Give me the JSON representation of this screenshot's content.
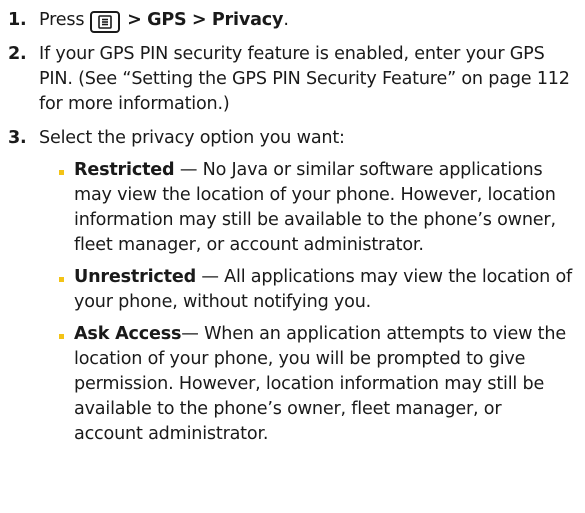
{
  "steps": [
    {
      "number": "1.",
      "text_before": "Press",
      "icon": "menu-key-icon",
      "path_sep1": ">",
      "path_item1": "GPS",
      "path_sep2": ">",
      "path_item2": "Privacy",
      "text_after": "."
    },
    {
      "number": "2.",
      "text": "If your GPS PIN security feature is enabled, enter your GPS PIN. (See “Setting the GPS PIN Security Feature” on page 112 for more information.)"
    },
    {
      "number": "3.",
      "text": "Select the privacy option you want:",
      "options": [
        {
          "term": "Restricted",
          "dash": " — ",
          "desc": "No Java or similar software applications may view the location of your phone. However, location information may still be available to the phone’s owner, fleet manager, or account administrator."
        },
        {
          "term": "Unrestricted",
          "dash": " — ",
          "desc": "All applications may view the location of your phone, without notifying you."
        },
        {
          "term": "Ask Access",
          "dash": "— ",
          "desc": "When an application attempts to view the location of your phone, you will be prompted to give permission. However, location information may still be available to the phone’s owner, fleet manager, or account administrator."
        }
      ]
    }
  ],
  "colors": {
    "bullet": "#f3c316",
    "text": "#1a1a1a"
  }
}
